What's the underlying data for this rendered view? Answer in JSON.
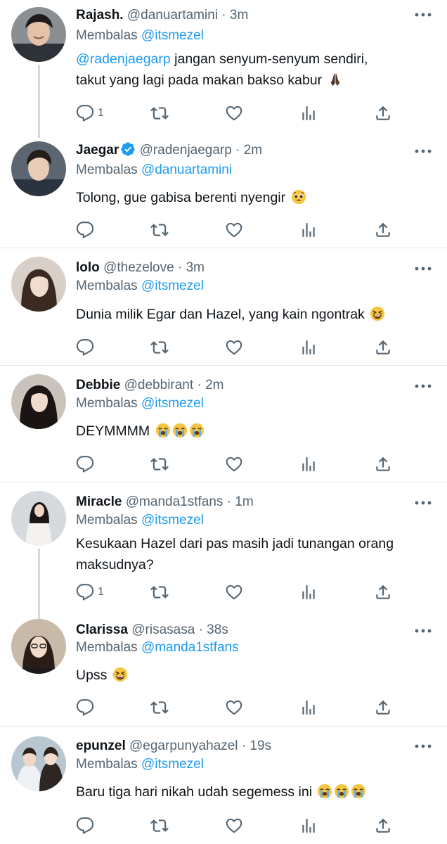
{
  "colors": {
    "link": "#1d9bf0",
    "muted": "#536471",
    "divider": "#e1e8ed",
    "verified": "#1d9bf0"
  },
  "icons": [
    "reply-icon",
    "retweet-icon",
    "like-icon",
    "views-icon",
    "share-icon",
    "more-icon",
    "verified-badge-icon"
  ],
  "replying_label": "Membalas",
  "tweets": [
    {
      "name": "Rajash.",
      "handle": "@danuartamini",
      "dot": "·",
      "time": "3m",
      "reply_to": "@itsmezel",
      "mention": "@radenjaegarp",
      "text_1": " jangan senyum-senyum sendiri,",
      "text_2": "takut yang lagi pada makan bakso kabur",
      "emoji": "folded-hands",
      "reply_count": "1"
    },
    {
      "name": "Jaegar",
      "handle": "@radenjaegarp",
      "dot": "·",
      "time": "2m",
      "verified": true,
      "reply_to": "@danuartamini",
      "text": "Tolong, gue gabisa berenti nyengir",
      "emoji": "pleading-face",
      "reply_count": ""
    },
    {
      "name": "lolo",
      "handle": "@thezelove",
      "dot": "·",
      "time": "3m",
      "reply_to": "@itsmezel",
      "text": "Dunia milik Egar dan Hazel, yang kain ngontrak",
      "emoji": "grinning-squinting-face",
      "reply_count": ""
    },
    {
      "name": "Debbie",
      "handle": "@debbirant",
      "dot": "·",
      "time": "2m",
      "reply_to": "@itsmezel",
      "text": "DEYMMMM",
      "emoji": "loudly-crying-face x3",
      "reply_count": ""
    },
    {
      "name": "Miracle",
      "handle": "@manda1stfans",
      "dot": "·",
      "time": "1m",
      "reply_to": "@itsmezel",
      "text_1": "Kesukaan Hazel dari pas masih jadi tunangan orang",
      "text_2": "maksudnya?",
      "reply_count": "1"
    },
    {
      "name": "Clarissa",
      "handle": "@risasasa",
      "dot": "·",
      "time": "38s",
      "reply_to": "@manda1stfans",
      "text": "Upss",
      "emoji": "grinning-squinting-face",
      "reply_count": ""
    },
    {
      "name": "epunzel",
      "handle": "@egarpunyahazel",
      "dot": "·",
      "time": "19s",
      "reply_to": "@itsmezel",
      "text": "Baru tiga hari nikah udah segemess ini",
      "emoji": "loudly-crying-face x3",
      "reply_count": ""
    }
  ]
}
